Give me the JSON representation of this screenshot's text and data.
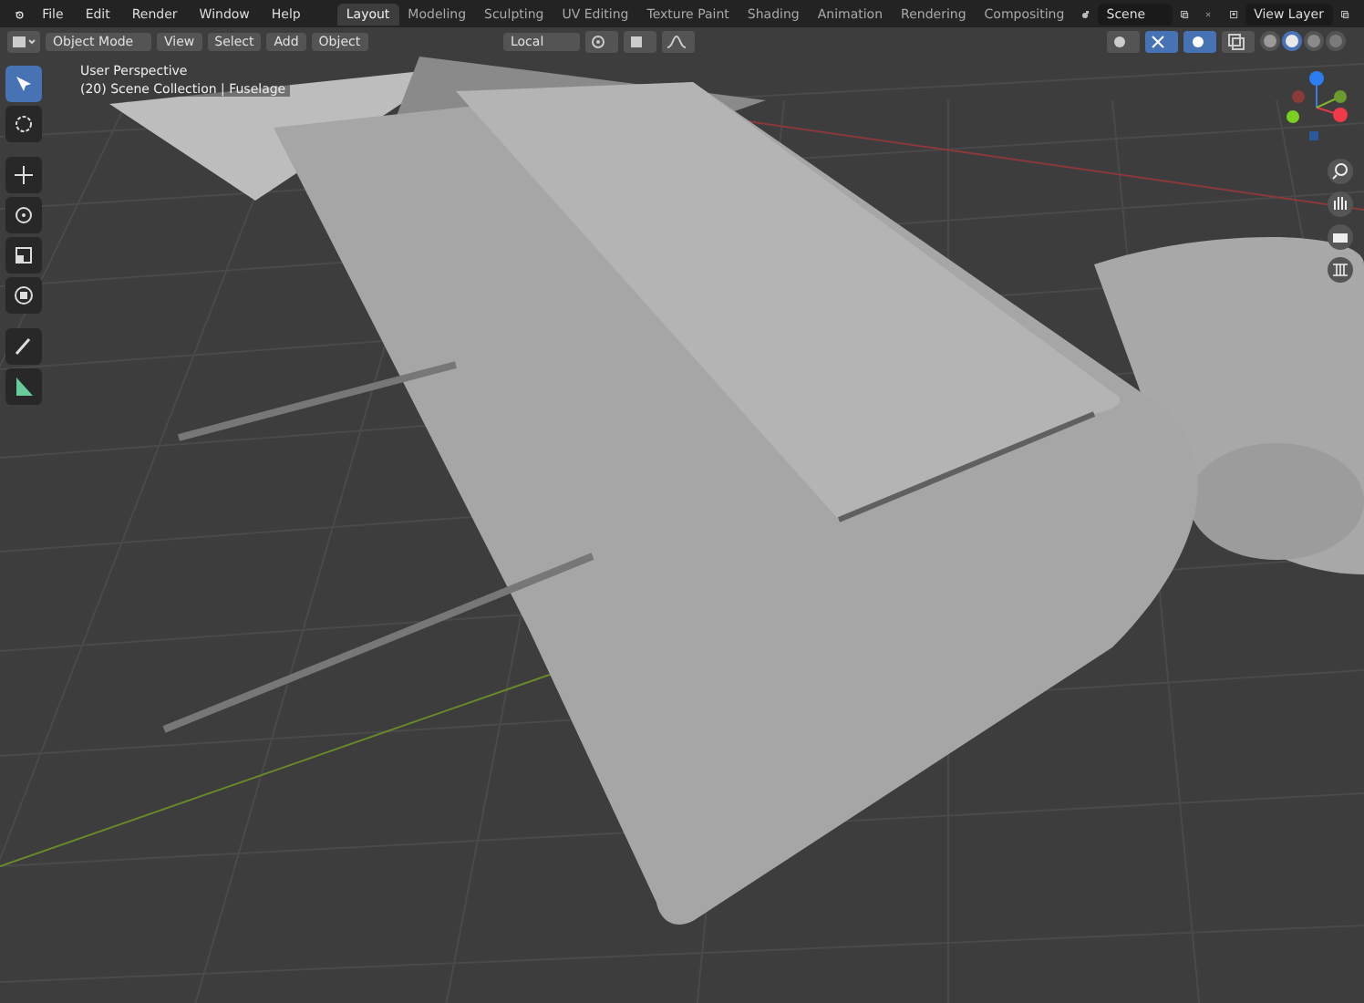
{
  "topbar": {
    "menus": [
      "File",
      "Edit",
      "Render",
      "Window",
      "Help"
    ],
    "workspaces": [
      {
        "label": "Layout",
        "selected": true
      },
      {
        "label": "Modeling",
        "selected": false
      },
      {
        "label": "Sculpting",
        "selected": false
      },
      {
        "label": "UV Editing",
        "selected": false
      },
      {
        "label": "Texture Paint",
        "selected": false
      },
      {
        "label": "Shading",
        "selected": false
      },
      {
        "label": "Animation",
        "selected": false
      },
      {
        "label": "Rendering",
        "selected": false
      },
      {
        "label": "Compositing",
        "selected": false
      }
    ],
    "scene": "Scene",
    "view_layer": "View Layer"
  },
  "header": {
    "mode": "Object Mode",
    "menus": [
      "View",
      "Select",
      "Add",
      "Object"
    ],
    "transform_orientation": "Local",
    "shading_modes": [
      {
        "kind": "wireframe",
        "selected": false
      },
      {
        "kind": "solid",
        "selected": true
      },
      {
        "kind": "material",
        "selected": false
      },
      {
        "kind": "rendered",
        "selected": false
      }
    ]
  },
  "viewport": {
    "perspective": "User Perspective",
    "collection": "(20) Scene Collection | Fuselage"
  },
  "toolbar": [
    {
      "kind": "select",
      "selected": true
    },
    {
      "kind": "cursor",
      "selected": false
    },
    {
      "kind": "move",
      "selected": false
    },
    {
      "kind": "rotate",
      "selected": false
    },
    {
      "kind": "scale",
      "selected": false
    },
    {
      "kind": "transform",
      "selected": false
    },
    {
      "kind": "annotate",
      "selected": false
    },
    {
      "kind": "measure",
      "selected": false
    }
  ]
}
